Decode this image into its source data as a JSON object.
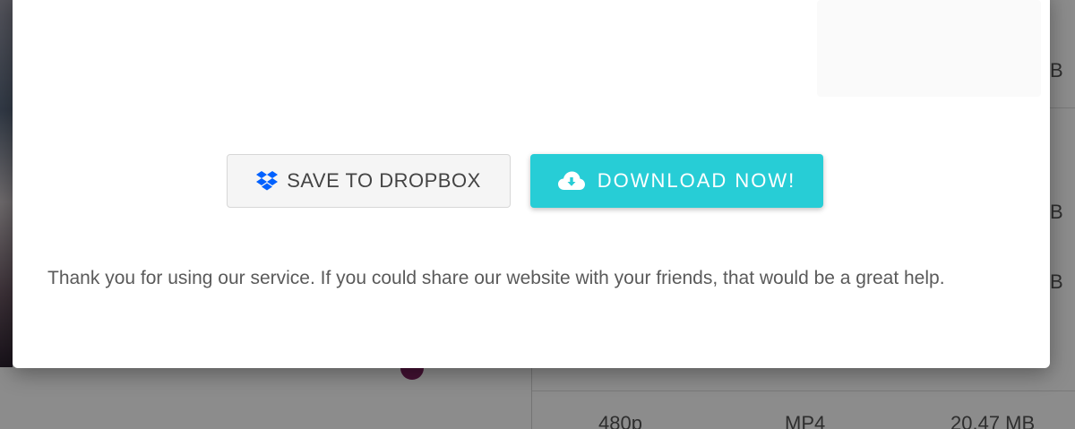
{
  "modal": {
    "dropbox_button_label": "SAVE TO DROPBOX",
    "download_button_label": "DOWNLOAD NOW!",
    "message": "Thank you for using our service. If you could share our website with your friends, that would be a great help.",
    "icons": {
      "dropbox": "dropbox-icon",
      "download": "cloud-download-icon"
    },
    "colors": {
      "download_button": "#27cdd6",
      "dropbox_icon": "#0061ff"
    }
  },
  "background": {
    "rows": [
      {
        "quality": "480p",
        "format": "MP4",
        "size": "20.47 MB"
      }
    ],
    "edge_letters": [
      "B",
      "B",
      "B"
    ]
  }
}
